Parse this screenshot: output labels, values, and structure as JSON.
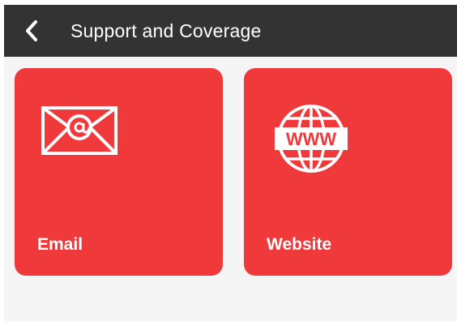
{
  "header": {
    "title": "Support and Coverage",
    "back_icon": "back-chevron-icon"
  },
  "tiles": [
    {
      "label": "Email",
      "icon": "email-envelope-icon"
    },
    {
      "label": "Website",
      "icon": "globe-www-icon",
      "icon_text": "WWW"
    }
  ],
  "colors": {
    "appbar": "#333333",
    "tile": "#ef393b",
    "background": "#f5f5f5",
    "foreground": "#ffffff"
  }
}
